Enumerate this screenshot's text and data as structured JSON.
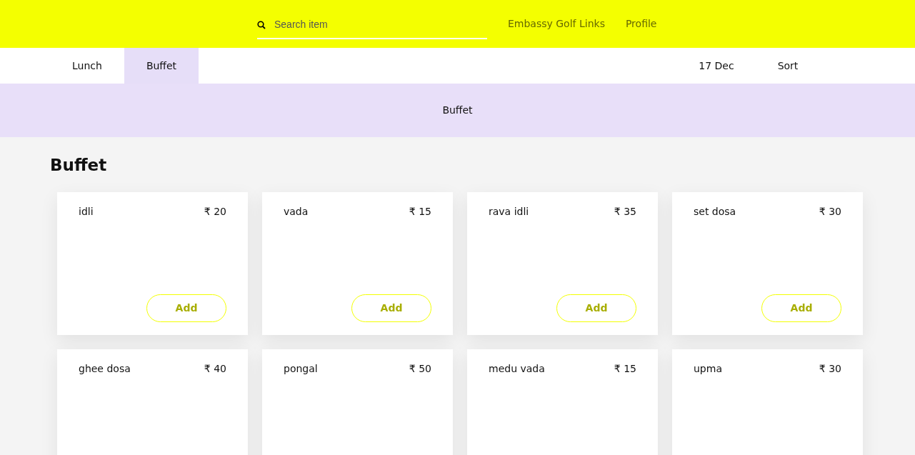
{
  "header": {
    "search": {
      "placeholder": "Search item"
    },
    "links": [
      "Embassy Golf Links",
      "Profile"
    ]
  },
  "tabs": [
    {
      "label": "Lunch",
      "selected": false
    },
    {
      "label": "Buffet",
      "selected": true
    }
  ],
  "nav_right": [
    "17 Dec",
    "Sort"
  ],
  "banner": "Buffet",
  "section_title": "Buffet",
  "items": [
    {
      "name": "idli",
      "price": "₹ 20",
      "button": "Add"
    },
    {
      "name": "vada",
      "price": "₹ 15",
      "button": "Add"
    },
    {
      "name": "rava idli",
      "price": "₹ 35",
      "button": "Add"
    },
    {
      "name": "set dosa",
      "price": "₹ 30",
      "button": "Add"
    },
    {
      "name": "ghee dosa",
      "price": "₹ 40"
    },
    {
      "name": "pongal",
      "price": "₹ 50"
    },
    {
      "name": "medu vada",
      "price": "₹ 15"
    },
    {
      "name": "upma",
      "price": "₹ 30"
    }
  ]
}
